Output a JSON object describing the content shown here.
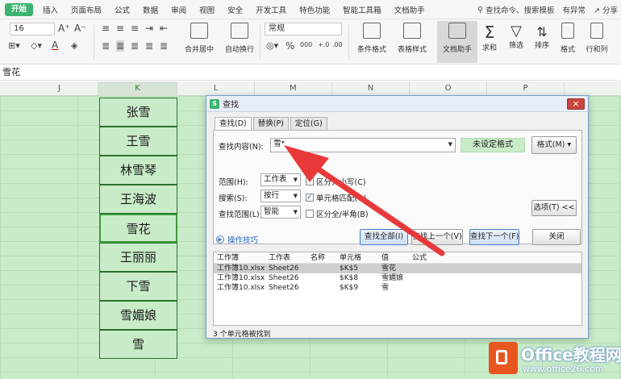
{
  "menu": {
    "tabs": [
      "开始",
      "插入",
      "页面布局",
      "公式",
      "数据",
      "审阅",
      "视图",
      "安全",
      "开发工具",
      "特色功能",
      "智能工具箱",
      "文档助手"
    ],
    "search_placeholder": "查找命令、搜索模板",
    "has_changes": "有异常",
    "share": "分享"
  },
  "ribbon": {
    "font_size": "16",
    "number_format": "常规",
    "merge_center": "合并居中",
    "wrap_text": "自动换行",
    "cond_format": "条件格式",
    "table_style": "表格样式",
    "doc_assistant": "文档助手",
    "sum": "求和",
    "filter": "筛选",
    "sort": "排序",
    "format": "格式",
    "rows_cols": "行和列",
    "percent": "%",
    "thousand": "000"
  },
  "formula_bar": {
    "value": "雪花"
  },
  "columns": [
    "J",
    "K",
    "L",
    "M",
    "N",
    "O",
    "P"
  ],
  "cells": [
    "张雪",
    "王雪",
    "林雪琴",
    "王海波",
    "雪花",
    "王丽丽",
    "下雪",
    "雪媚娘",
    "雪"
  ],
  "dialog": {
    "title": "查找",
    "tabs": [
      "查找(D)",
      "替换(P)",
      "定位(G)"
    ],
    "find_label": "查找内容(N):",
    "find_value": "雪*",
    "format_status": "未设定格式",
    "format_button": "格式(M)",
    "scope_label": "范围(H):",
    "scope_value": "工作表",
    "search_label": "搜索(S):",
    "search_value": "按行",
    "lookin_label": "查找范围(L):",
    "lookin_value": "智能",
    "opt_case": "区分大小写(C)",
    "opt_whole": "单元格匹配(O)",
    "opt_width": "区分全/半角(B)",
    "options_button": "选项(T) <<",
    "tips_link": "操作技巧",
    "find_all": "查找全部(I)",
    "find_prev": "查找上一个(V)",
    "find_next": "查找下一个(F)",
    "close": "关闭",
    "result_headers": [
      "工作簿",
      "工作表",
      "名称",
      "单元格",
      "值",
      "公式"
    ],
    "results": [
      [
        "工作簿10.xlsx",
        "Sheet26",
        "",
        "$K$5",
        "雪花",
        ""
      ],
      [
        "工作簿10.xlsx",
        "Sheet26",
        "",
        "$K$8",
        "雪媚娘",
        ""
      ],
      [
        "工作簿10.xlsx",
        "Sheet26",
        "",
        "$K$9",
        "雪",
        ""
      ]
    ],
    "status": "3 个单元格被找到"
  },
  "watermark": {
    "brand": "Office教程网",
    "url": "www.office26.com"
  }
}
